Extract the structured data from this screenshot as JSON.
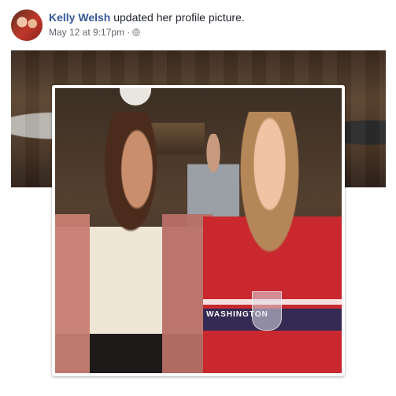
{
  "post": {
    "author": "Kelly Welsh",
    "action": " updated her profile picture.",
    "timestamp": "May 12 at 9:17pm",
    "separator": "·",
    "privacy_icon": "globe-icon"
  },
  "photo": {
    "jersey_text": "WASHINGTON"
  },
  "colors": {
    "link": "#365899",
    "meta": "#616770",
    "text": "#1d2129"
  }
}
